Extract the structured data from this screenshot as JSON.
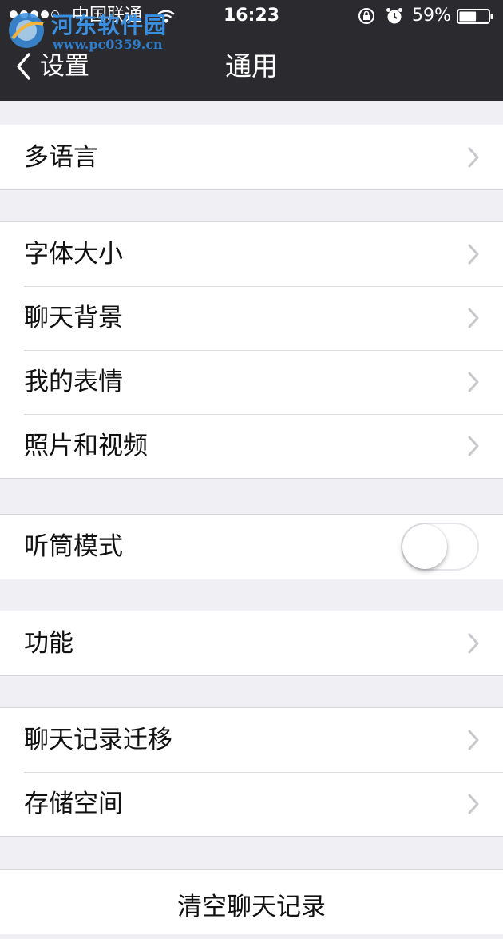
{
  "status_bar": {
    "carrier": "中国联通",
    "time": "16:23",
    "battery": "59%",
    "battery_level": 0.59,
    "signal_dots_filled": 4,
    "signal_dots_total": 5,
    "icons": [
      "wifi-icon",
      "rotation-lock-icon",
      "alarm-icon",
      "battery-icon"
    ]
  },
  "watermark": {
    "title": "河东软件园",
    "url": "www.pc0359.cn"
  },
  "nav": {
    "back_label": "设置",
    "title": "通用"
  },
  "groups": [
    {
      "rows": [
        {
          "label": "多语言",
          "accessory": "chevron"
        }
      ]
    },
    {
      "rows": [
        {
          "label": "字体大小",
          "accessory": "chevron"
        },
        {
          "label": "聊天背景",
          "accessory": "chevron"
        },
        {
          "label": "我的表情",
          "accessory": "chevron"
        },
        {
          "label": "照片和视频",
          "accessory": "chevron"
        }
      ]
    },
    {
      "rows": [
        {
          "label": "听筒模式",
          "accessory": "toggle",
          "toggle_on": false
        }
      ]
    },
    {
      "rows": [
        {
          "label": "功能",
          "accessory": "chevron"
        }
      ]
    },
    {
      "rows": [
        {
          "label": "聊天记录迁移",
          "accessory": "chevron"
        },
        {
          "label": "存储空间",
          "accessory": "chevron"
        }
      ]
    },
    {
      "rows": [
        {
          "label": "清空聊天记录",
          "accessory": "none"
        }
      ]
    }
  ],
  "colors": {
    "nav_background": "#2b2b2f",
    "page_background": "#efeff4",
    "chevron": "#c7c7cc",
    "watermark": "#3a8fe0"
  }
}
